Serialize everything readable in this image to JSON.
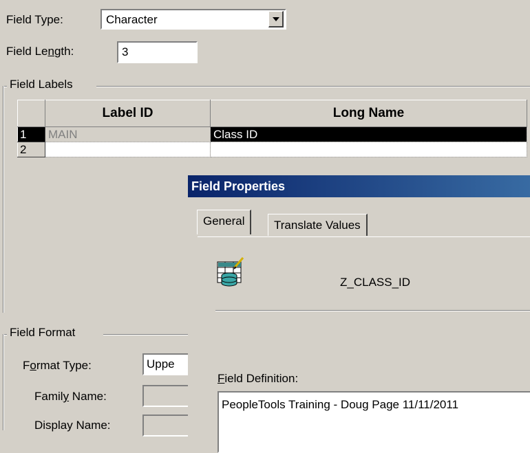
{
  "field_type": {
    "label": "Field Type:",
    "value": "Character"
  },
  "field_length": {
    "label_pre": "Field Le",
    "label_ul": "n",
    "label_post": "gth:",
    "value": "3"
  },
  "field_labels": {
    "group_label": "Field Labels",
    "columns": [
      "Label ID",
      "Long Name"
    ],
    "rows": [
      {
        "num": "1",
        "label_id": "MAIN",
        "long_name": "Class ID"
      },
      {
        "num": "2",
        "label_id": "",
        "long_name": ""
      }
    ]
  },
  "field_format": {
    "group_label": "Field Format",
    "format_type": {
      "label_pre": "F",
      "label_ul": "o",
      "label_post": "rmat Type:",
      "value": "Uppe"
    },
    "family_name": {
      "label_pre": "Famil",
      "label_ul": "y",
      "label_post": " Name:",
      "value": ""
    },
    "display_name": {
      "label": "Display Name:",
      "value": ""
    }
  },
  "dialog": {
    "title": "Field Properties",
    "tabs": [
      "General",
      "Translate Values"
    ],
    "field_name": "Z_CLASS_ID",
    "field_definition": {
      "label_ul": "F",
      "label_post": "ield Definition:",
      "value": "PeopleTools Training - Doug Page 11/11/2011"
    }
  }
}
